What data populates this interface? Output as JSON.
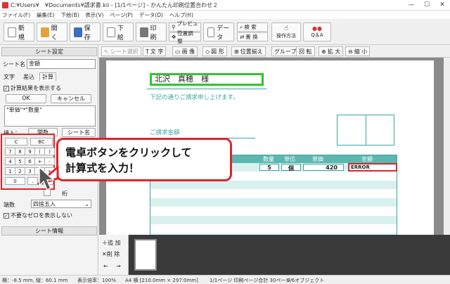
{
  "window": {
    "title": "C:¥Users¥　¥Documents¥請求書.kii - [1/1ページ] - かんたん印刷位置合わせ２",
    "min": "—",
    "max": "☐",
    "close": "✕"
  },
  "menu": [
    "ファイル(F)",
    "編集(E)",
    "下絵(B)",
    "表示(V)",
    "ページ(P)",
    "データ(D)",
    "ヘルプ(H)"
  ],
  "toolbar": {
    "new": "新 規",
    "open": "開 く",
    "save": "保 存",
    "download": "下 絵",
    "print": "印 刷",
    "preview": "プレビュー",
    "position_adjust": "位置調整",
    "data": "データ",
    "search": "検 索",
    "replace": "置 換",
    "howto": "操作方法",
    "qa": "Q＆A"
  },
  "left_panel": {
    "sheet_settings": "シート設定",
    "sheet_name_label": "シート名",
    "sheet_name_value": "金額",
    "tabs": [
      "文字",
      "差込",
      "計算"
    ],
    "show_result_label": "計算結果を表示する",
    "ok": "OK",
    "cancel": "キャンセル",
    "formula": "\"単価\"*\"数量\"",
    "insert_label": "挿入：",
    "calc_btn": "関数",
    "sheet_name_btn": "シート名",
    "digits_suffix": "桁",
    "rounding_label": "端数",
    "rounding_value": "四捨五入",
    "hide_zero_label": "不要なゼロを表示しない",
    "sheet_info": "シート情報",
    "calc_keys": [
      "C",
      "BC",
      "7",
      "8",
      "9",
      "(",
      ")",
      "4",
      "5",
      "6",
      "+",
      "-",
      "1",
      "2",
      "3",
      "×",
      "÷",
      "0",
      ".",
      "="
    ]
  },
  "subtoolbar": {
    "sheet_select": "シート選択",
    "text": "文 字",
    "image": "画 像",
    "shape": "図 形",
    "align": "位置揃え",
    "group": "グループ",
    "rotate": "回 転",
    "zoom_in": "拡 大",
    "zoom_out": "縮 小"
  },
  "document": {
    "recipient": "北沢　真穂　様",
    "greeting": "下記の通りご請求申し上げます。",
    "amount_label": "ご請求金額",
    "columns": [
      "数量",
      "単位",
      "単価",
      "金額"
    ],
    "row1": {
      "qty": "5",
      "unit": "個",
      "price": "420",
      "amount": "ERROR"
    }
  },
  "thumbs": {
    "add": "追 加",
    "delete": "削 除"
  },
  "status": {
    "coords": "横：-8.5 mm, 縦：60.1 mm",
    "zoom": "表示倍率：100%",
    "paper": "A4 横 [210.0mm × 297.0mm]",
    "pages": "1/1ページ 印刷ページ合計 30ページ",
    "objects": "6/6オブジェクト"
  },
  "callout": {
    "line1": "電卓ボタンをクリックして",
    "line2": "計算式を入力！"
  },
  "colors": {
    "accent_red": "#d9262c",
    "doc_teal": "#3aa6a0",
    "highlight_green": "#34c234",
    "header_teal": "#5bb7b0"
  }
}
